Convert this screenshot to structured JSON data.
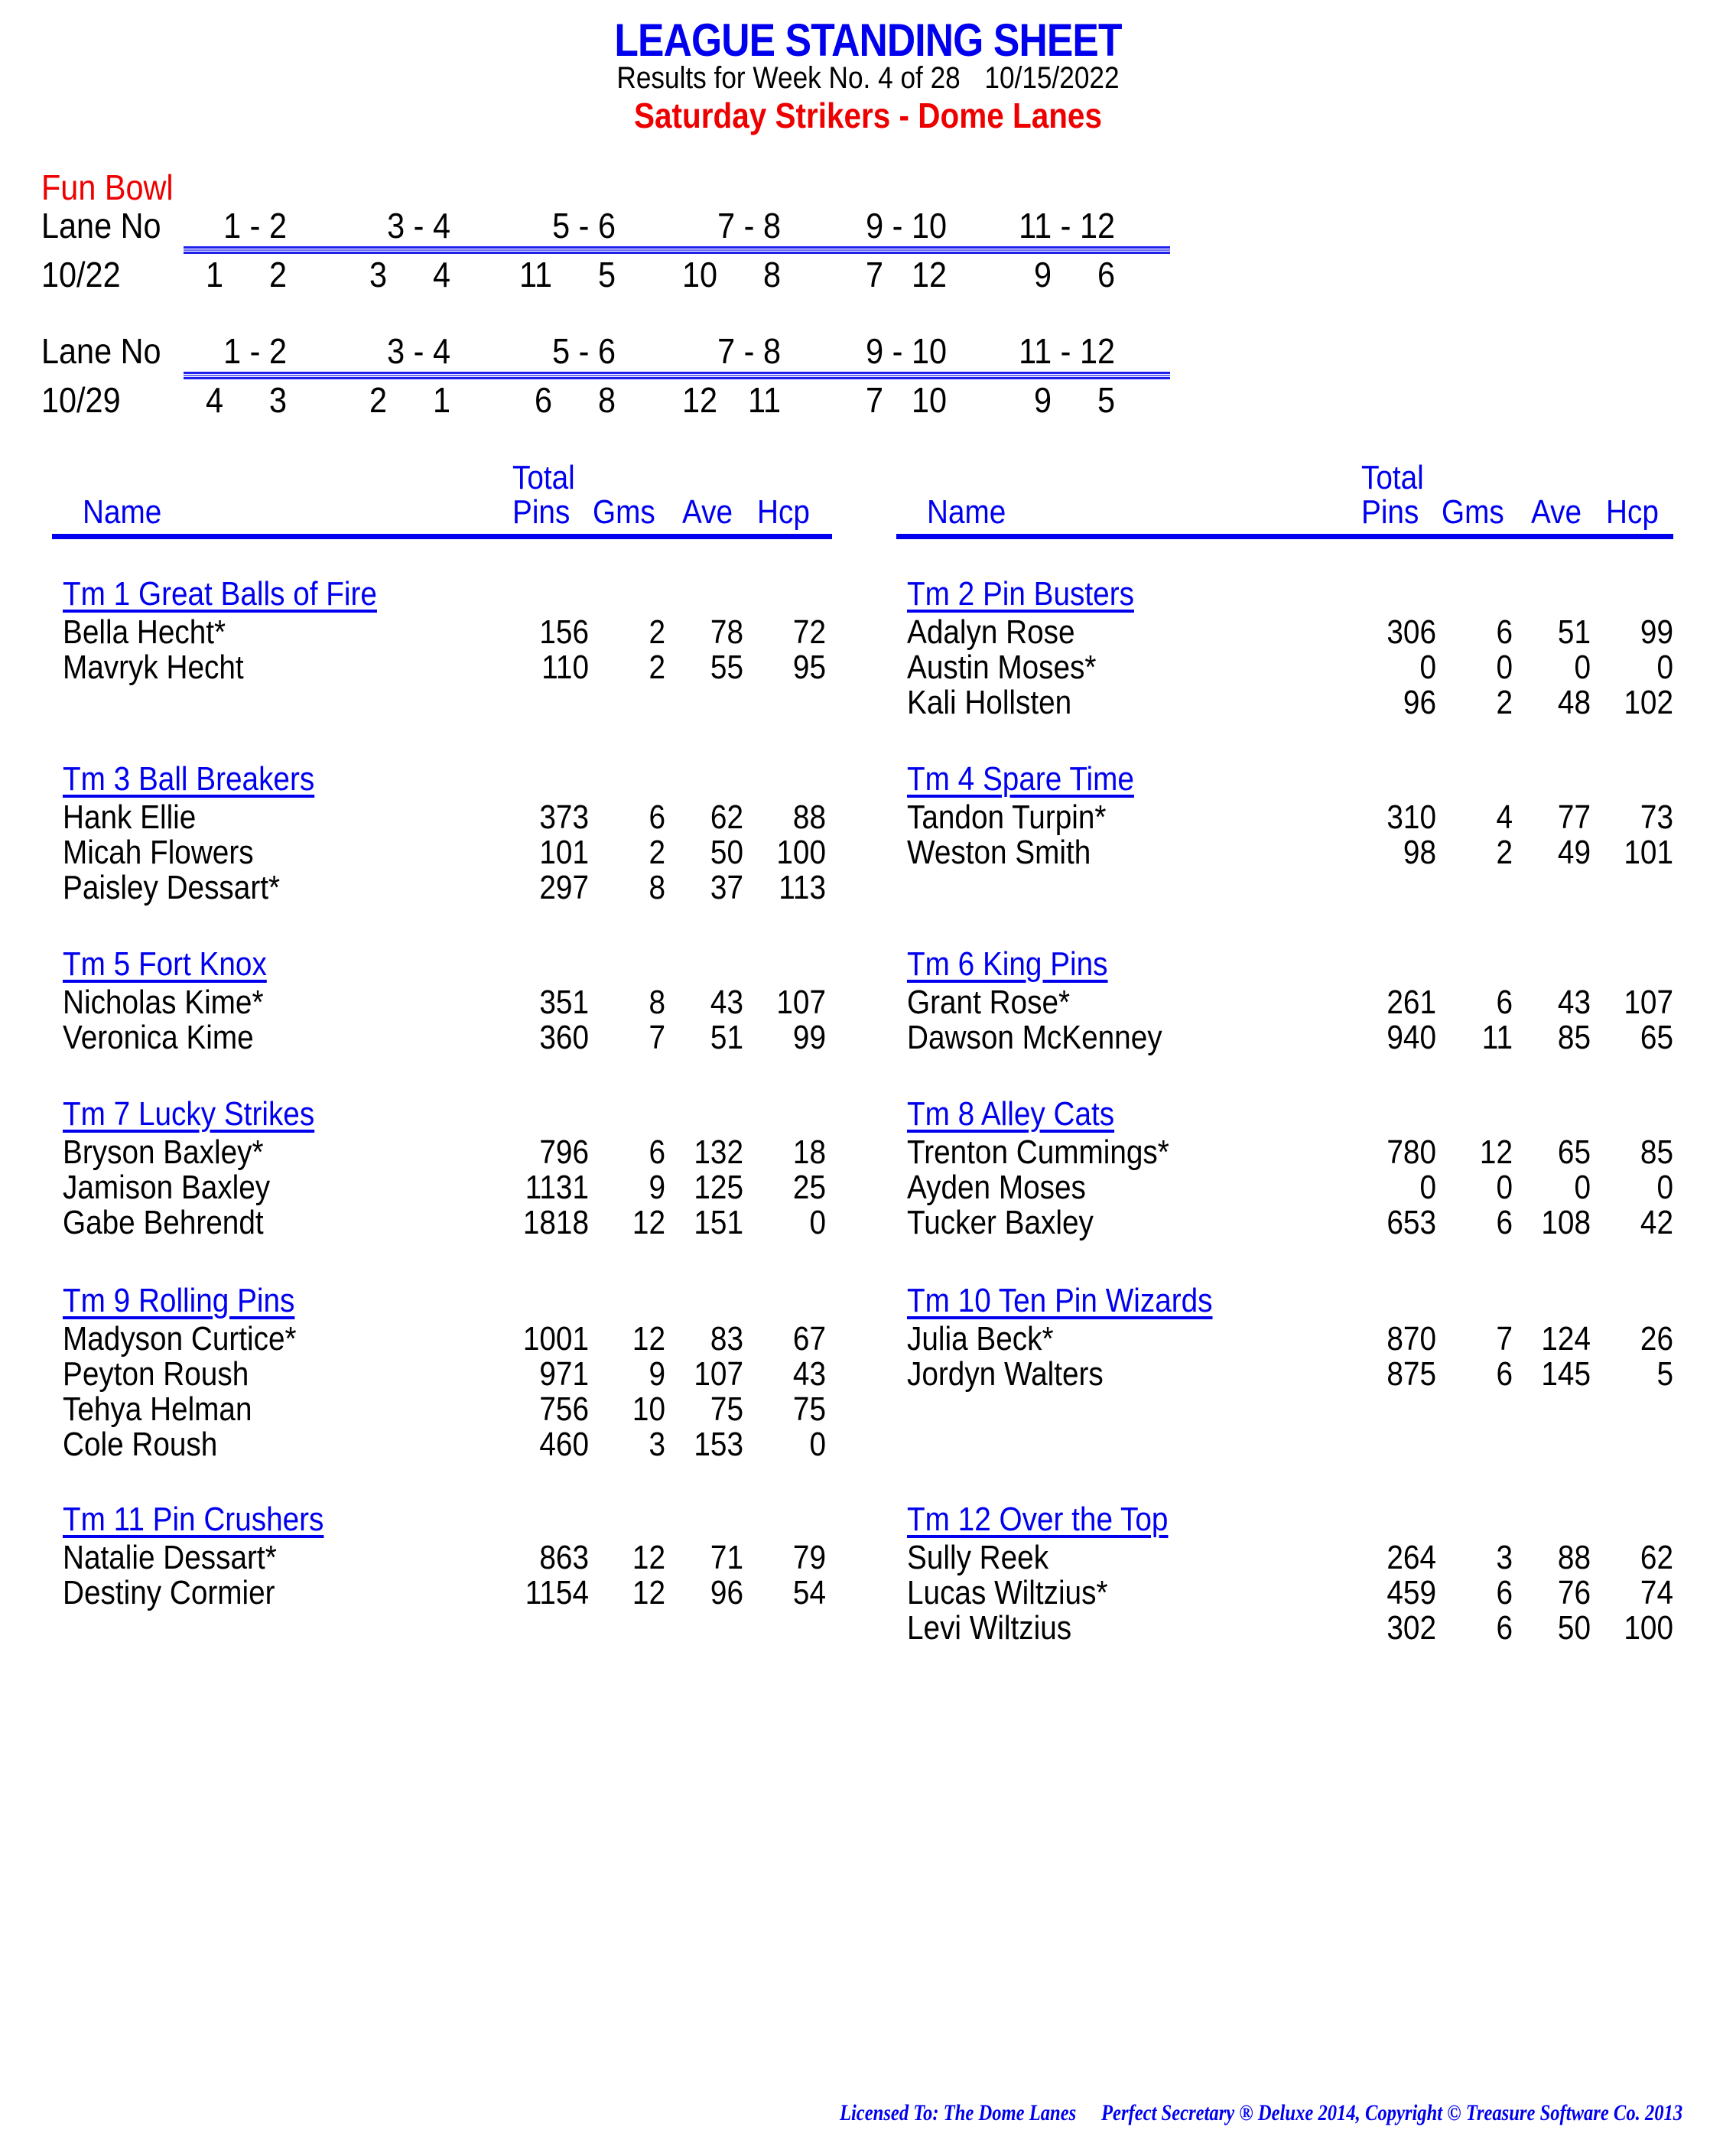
{
  "header": {
    "title": "LEAGUE STANDING SHEET",
    "results_label": "Results for Week No. 4 of 28",
    "date": "10/15/2022",
    "league": "Saturday Strikers - Dome Lanes"
  },
  "lane_assignments": {
    "section_title": "Fun Bowl",
    "lane_label": "Lane No",
    "lane_pairs": [
      "1 -  2",
      "3 -  4",
      "5 -  6",
      "7 -  8",
      "9 - 10",
      "11 - 12"
    ],
    "schedules": [
      {
        "date": "10/22",
        "matchups": [
          [
            "1",
            "2"
          ],
          [
            "3",
            "4"
          ],
          [
            "11",
            "5"
          ],
          [
            "10",
            "8"
          ],
          [
            "7",
            "12"
          ],
          [
            "9",
            "6"
          ]
        ]
      },
      {
        "date": "10/29",
        "matchups": [
          [
            "4",
            "3"
          ],
          [
            "2",
            "1"
          ],
          [
            "6",
            "8"
          ],
          [
            "12",
            "11"
          ],
          [
            "7",
            "10"
          ],
          [
            "9",
            "5"
          ]
        ]
      }
    ]
  },
  "columns": {
    "total": "Total",
    "name": "Name",
    "pins": "Pins",
    "gms": "Gms",
    "ave": "Ave",
    "hcp": "Hcp"
  },
  "teams": [
    {
      "name": "Tm 1 Great Balls of Fire",
      "players": [
        {
          "name": "Bella Hecht*",
          "pins": "156",
          "gms": "2",
          "ave": "78",
          "hcp": "72"
        },
        {
          "name": "Mavryk Hecht",
          "pins": "110",
          "gms": "2",
          "ave": "55",
          "hcp": "95"
        }
      ]
    },
    {
      "name": "Tm 2 Pin Busters",
      "players": [
        {
          "name": "Adalyn Rose",
          "pins": "306",
          "gms": "6",
          "ave": "51",
          "hcp": "99"
        },
        {
          "name": "Austin Moses*",
          "pins": "0",
          "gms": "0",
          "ave": "0",
          "hcp": "0"
        },
        {
          "name": "Kali Hollsten",
          "pins": "96",
          "gms": "2",
          "ave": "48",
          "hcp": "102"
        }
      ]
    },
    {
      "name": "Tm 3 Ball Breakers",
      "players": [
        {
          "name": "Hank Ellie",
          "pins": "373",
          "gms": "6",
          "ave": "62",
          "hcp": "88"
        },
        {
          "name": "Micah Flowers",
          "pins": "101",
          "gms": "2",
          "ave": "50",
          "hcp": "100"
        },
        {
          "name": "Paisley Dessart*",
          "pins": "297",
          "gms": "8",
          "ave": "37",
          "hcp": "113"
        }
      ]
    },
    {
      "name": "Tm 4 Spare Time",
      "players": [
        {
          "name": "Tandon Turpin*",
          "pins": "310",
          "gms": "4",
          "ave": "77",
          "hcp": "73"
        },
        {
          "name": "Weston Smith",
          "pins": "98",
          "gms": "2",
          "ave": "49",
          "hcp": "101"
        }
      ]
    },
    {
      "name": "Tm 5 Fort Knox",
      "players": [
        {
          "name": "Nicholas Kime*",
          "pins": "351",
          "gms": "8",
          "ave": "43",
          "hcp": "107"
        },
        {
          "name": "Veronica Kime",
          "pins": "360",
          "gms": "7",
          "ave": "51",
          "hcp": "99"
        }
      ]
    },
    {
      "name": "Tm 6 King Pins",
      "players": [
        {
          "name": "Grant Rose*",
          "pins": "261",
          "gms": "6",
          "ave": "43",
          "hcp": "107"
        },
        {
          "name": "Dawson McKenney",
          "pins": "940",
          "gms": "11",
          "ave": "85",
          "hcp": "65"
        }
      ]
    },
    {
      "name": "Tm 7 Lucky Strikes",
      "players": [
        {
          "name": "Bryson Baxley*",
          "pins": "796",
          "gms": "6",
          "ave": "132",
          "hcp": "18"
        },
        {
          "name": "Jamison Baxley",
          "pins": "1131",
          "gms": "9",
          "ave": "125",
          "hcp": "25"
        },
        {
          "name": "Gabe Behrendt",
          "pins": "1818",
          "gms": "12",
          "ave": "151",
          "hcp": "0"
        }
      ]
    },
    {
      "name": "Tm 8 Alley Cats",
      "players": [
        {
          "name": "Trenton Cummings*",
          "pins": "780",
          "gms": "12",
          "ave": "65",
          "hcp": "85"
        },
        {
          "name": "Ayden Moses",
          "pins": "0",
          "gms": "0",
          "ave": "0",
          "hcp": "0"
        },
        {
          "name": "Tucker Baxley",
          "pins": "653",
          "gms": "6",
          "ave": "108",
          "hcp": "42"
        }
      ]
    },
    {
      "name": "Tm 9 Rolling Pins",
      "players": [
        {
          "name": "Madyson Curtice*",
          "pins": "1001",
          "gms": "12",
          "ave": "83",
          "hcp": "67"
        },
        {
          "name": "Peyton Roush",
          "pins": "971",
          "gms": "9",
          "ave": "107",
          "hcp": "43"
        },
        {
          "name": "Tehya Helman",
          "pins": "756",
          "gms": "10",
          "ave": "75",
          "hcp": "75"
        },
        {
          "name": "Cole Roush",
          "pins": "460",
          "gms": "3",
          "ave": "153",
          "hcp": "0"
        }
      ]
    },
    {
      "name": "Tm 10 Ten Pin Wizards",
      "players": [
        {
          "name": "Julia Beck*",
          "pins": "870",
          "gms": "7",
          "ave": "124",
          "hcp": "26"
        },
        {
          "name": "Jordyn Walters",
          "pins": "875",
          "gms": "6",
          "ave": "145",
          "hcp": "5"
        }
      ]
    },
    {
      "name": "Tm 11 Pin Crushers",
      "players": [
        {
          "name": "Natalie Dessart*",
          "pins": "863",
          "gms": "12",
          "ave": "71",
          "hcp": "79"
        },
        {
          "name": "Destiny Cormier",
          "pins": "1154",
          "gms": "12",
          "ave": "96",
          "hcp": "54"
        }
      ]
    },
    {
      "name": "Tm 12 Over the Top",
      "players": [
        {
          "name": "Sully Reek",
          "pins": "264",
          "gms": "3",
          "ave": "88",
          "hcp": "62"
        },
        {
          "name": "Lucas Wiltzius*",
          "pins": "459",
          "gms": "6",
          "ave": "76",
          "hcp": "74"
        },
        {
          "name": "Levi Wiltzius",
          "pins": "302",
          "gms": "6",
          "ave": "50",
          "hcp": "100"
        }
      ]
    }
  ],
  "footer": {
    "licensed": "Licensed To: The Dome Lanes",
    "software": "Perfect Secretary ® Deluxe  2014, Copyright © Treasure Software Co. 2013"
  },
  "colors": {
    "title_blue": "#0000ee",
    "league_red": "#ee0000",
    "text": "#000000"
  }
}
